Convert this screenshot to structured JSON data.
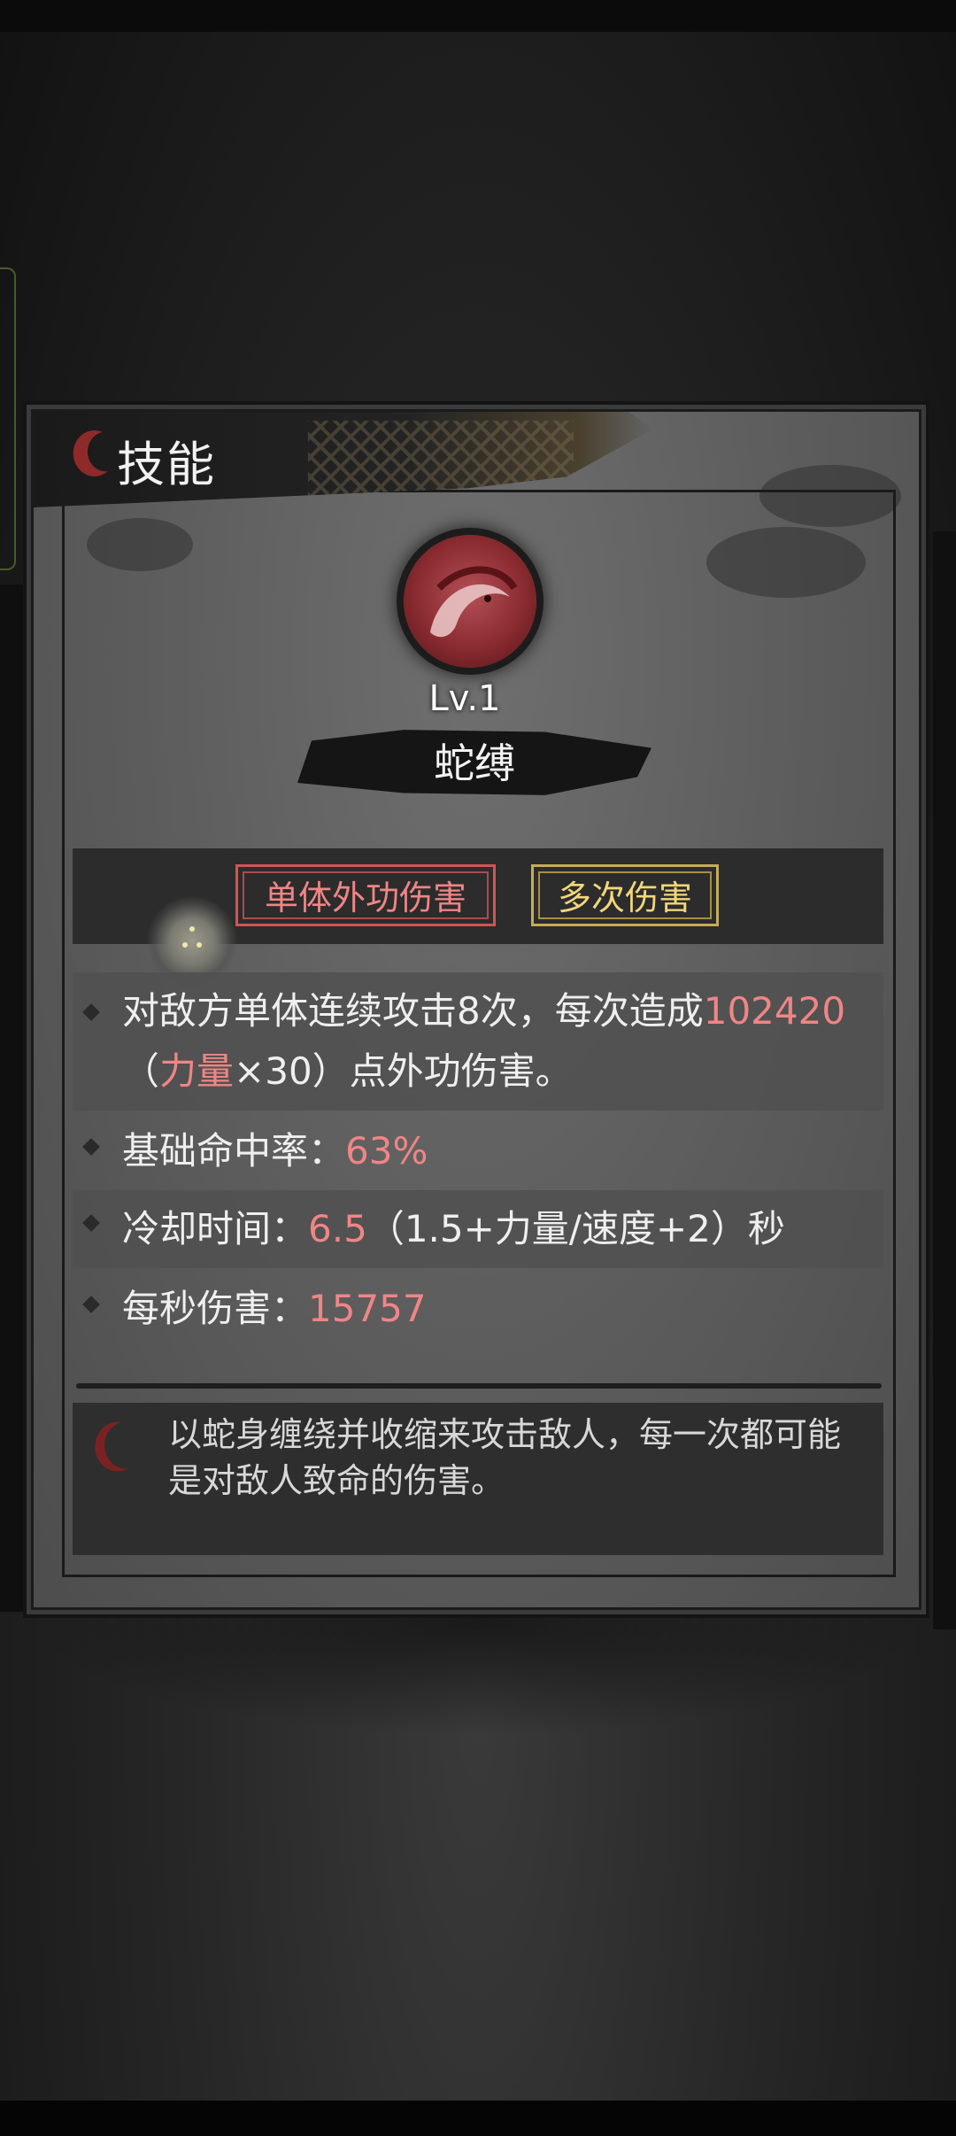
{
  "header": {
    "title": "技能"
  },
  "skill": {
    "level": "Lv.1",
    "name": "蛇缚",
    "icon": "serpent-emblem-icon"
  },
  "tags": [
    {
      "label": "单体外功伤害",
      "color": "#f08585"
    },
    {
      "label": "多次伤害",
      "color": "#f2d77a"
    }
  ],
  "stats": {
    "attack": {
      "prefix": "对敌方单体连续攻击8次，每次造成",
      "value": "102420",
      "paren_open": "（",
      "stat": "力量",
      "multiplier": "×30）点外功伤害。"
    },
    "hit_rate": {
      "label": "基础命中率：",
      "value": "63%"
    },
    "cooldown": {
      "label": "冷却时间：",
      "value": "6.5",
      "formula": "（1.5+力量/速度+2）秒"
    },
    "dps": {
      "label": "每秒伤害：",
      "value": "15757"
    }
  },
  "description": {
    "text": "以蛇身缠绕并收缩来攻击敌人，每一次都可能是对敌人致命的伤害。",
    "icon": "crescent-emblem-icon"
  },
  "colors": {
    "accent_red": "#f08585",
    "accent_gold": "#f2d77a"
  }
}
